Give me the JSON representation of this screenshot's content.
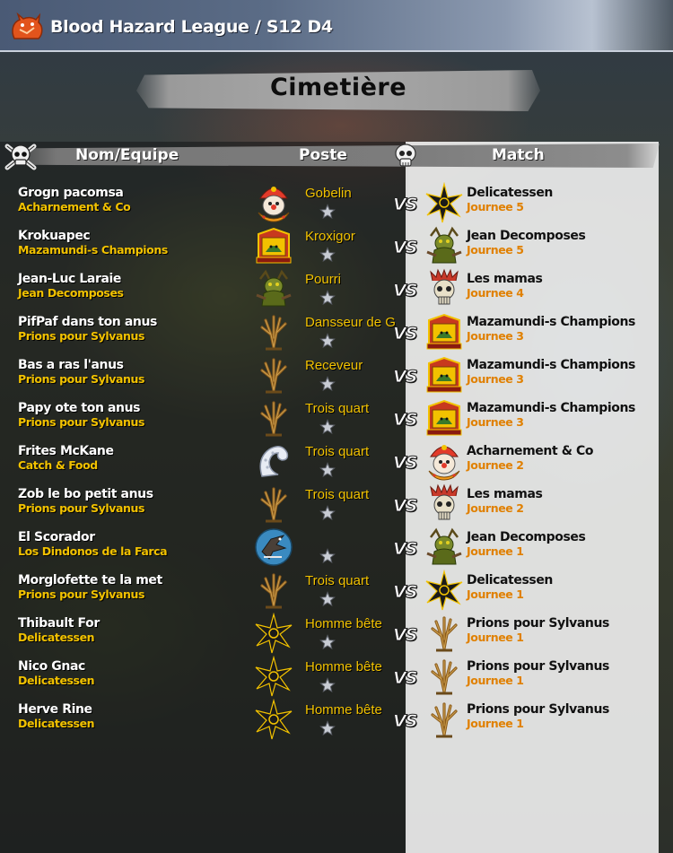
{
  "header": {
    "league_title": "Blood Hazard League / S12 D4",
    "logo_icon": "blood-hazard-logo"
  },
  "page_title": "Cimetière",
  "columns": {
    "name_team": "Nom/Equipe",
    "position": "Poste",
    "match": "Match"
  },
  "vs_label": "VS",
  "colors": {
    "team_yellow": "#f2c200",
    "round_orange": "#e08000",
    "header_bar": "#5b6c86"
  },
  "rows": [
    {
      "name": "Grogn pacomsa",
      "team": "Acharnement & Co",
      "team_icon": "clown-logo",
      "position": "Gobelin",
      "opponent": "Delicatessen",
      "opponent_icon": "chaos-star-logo",
      "round": "Journee 5"
    },
    {
      "name": "Krokuapec",
      "team": "Mazamundi-s Champions",
      "team_icon": "lizardmen-logo",
      "position": "Kroxigor",
      "opponent": "Jean Decomposes",
      "opponent_icon": "nurgle-logo",
      "round": "Journee 5"
    },
    {
      "name": "Jean-Luc Laraie",
      "team": "Jean Decomposes",
      "team_icon": "nurgle-logo",
      "position": "Pourri",
      "opponent": "Les mamas",
      "opponent_icon": "skull-logo",
      "round": "Journee 4"
    },
    {
      "name": "PifPaf dans ton anus",
      "team": "Prions pour Sylvanus",
      "team_icon": "treeman-logo",
      "position": "Dansseur de G",
      "opponent": "Mazamundi-s Champions",
      "opponent_icon": "lizardmen-logo",
      "round": "Journee 3"
    },
    {
      "name": "Bas a ras l'anus",
      "team": "Prions pour Sylvanus",
      "team_icon": "treeman-logo",
      "position": "Receveur",
      "opponent": "Mazamundi-s Champions",
      "opponent_icon": "lizardmen-logo",
      "round": "Journee 3"
    },
    {
      "name": "Papy ote ton anus",
      "team": "Prions pour Sylvanus",
      "team_icon": "treeman-logo",
      "position": "Trois quart",
      "opponent": "Mazamundi-s Champions",
      "opponent_icon": "lizardmen-logo",
      "round": "Journee 3"
    },
    {
      "name": "Frites McKane",
      "team": "Catch & Food",
      "team_icon": "tentacle-logo",
      "position": "Trois quart",
      "opponent": "Acharnement & Co",
      "opponent_icon": "clown-logo",
      "round": "Journee 2"
    },
    {
      "name": "Zob le bo petit anus",
      "team": "Prions pour Sylvanus",
      "team_icon": "treeman-logo",
      "position": "Trois quart",
      "opponent": "Les mamas",
      "opponent_icon": "skull-logo",
      "round": "Journee 2"
    },
    {
      "name": "El Scorador",
      "team": "Los Dindonos de la Farca",
      "team_icon": "bird-logo",
      "position": "",
      "opponent": "Jean Decomposes",
      "opponent_icon": "nurgle-logo",
      "round": "Journee 1"
    },
    {
      "name": "Morglofette te la met",
      "team": "Prions pour Sylvanus",
      "team_icon": "treeman-logo",
      "position": "Trois quart",
      "opponent": "Delicatessen",
      "opponent_icon": "chaos-star-logo",
      "round": "Journee 1"
    },
    {
      "name": "Thibault For",
      "team": "Delicatessen",
      "team_icon": "chaos-star-logo",
      "position": "Homme bête",
      "opponent": "Prions pour Sylvanus",
      "opponent_icon": "treeman-logo",
      "round": "Journee 1"
    },
    {
      "name": "Nico Gnac",
      "team": "Delicatessen",
      "team_icon": "chaos-star-logo",
      "position": "Homme bête",
      "opponent": "Prions pour Sylvanus",
      "opponent_icon": "treeman-logo",
      "round": "Journee 1"
    },
    {
      "name": "Herve Rine",
      "team": "Delicatessen",
      "team_icon": "chaos-star-logo",
      "position": "Homme bête",
      "opponent": "Prions pour Sylvanus",
      "opponent_icon": "treeman-logo",
      "round": "Journee 1"
    }
  ]
}
